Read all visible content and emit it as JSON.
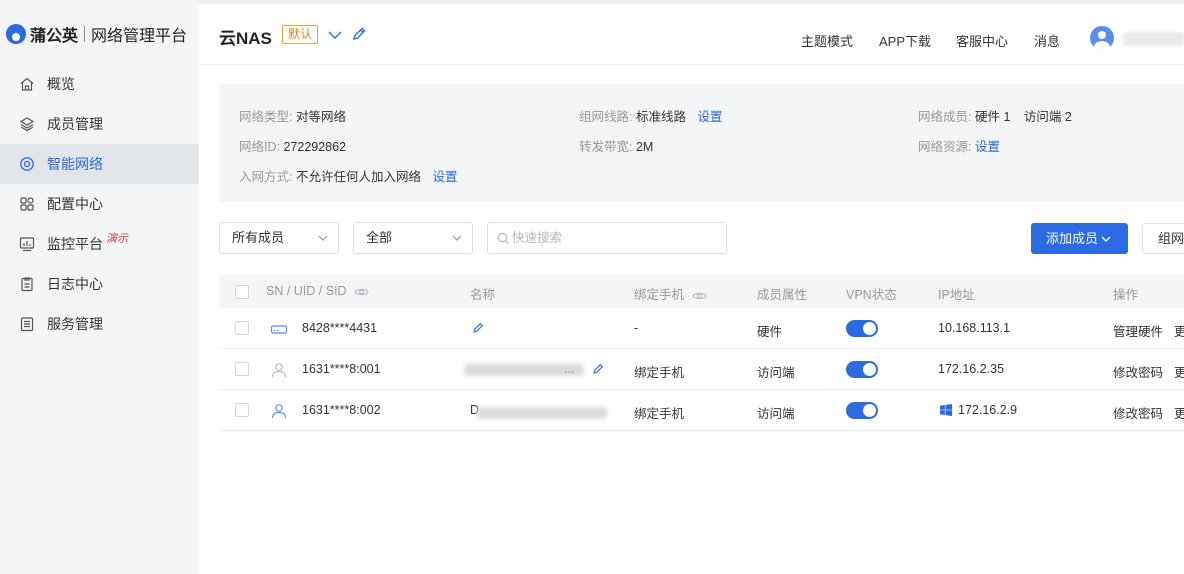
{
  "brand": {
    "name": "蒲公英",
    "subtitle": "网络管理平台"
  },
  "sidebar": {
    "items": [
      {
        "label": "概览",
        "icon": "home-icon",
        "active": false
      },
      {
        "label": "成员管理",
        "icon": "layers-icon",
        "active": false
      },
      {
        "label": "智能网络",
        "icon": "network-icon",
        "active": true
      },
      {
        "label": "配置中心",
        "icon": "grid-icon",
        "active": false
      },
      {
        "label": "监控平台",
        "icon": "monitor-chart-icon",
        "active": false,
        "tag": "演示"
      },
      {
        "label": "日志中心",
        "icon": "clipboard-icon",
        "active": false
      },
      {
        "label": "服务管理",
        "icon": "document-icon",
        "active": false
      }
    ]
  },
  "header": {
    "network_name": "云NAS",
    "default_badge": "默认",
    "links": [
      "主题模式",
      "APP下载",
      "客服中心",
      "消息"
    ]
  },
  "info": {
    "type_label": "网络类型:",
    "type_value": "对等网络",
    "route_label": "组网线路:",
    "route_value": "标准线路",
    "route_action": "设置",
    "members_label": "网络成员:",
    "members_hw": "硬件 1",
    "members_access": "访问端 2",
    "id_label": "网络ID:",
    "id_value": "272292862",
    "bandwidth_label": "转发带宽:",
    "bandwidth_value": "2M",
    "resources_label": "网络资源:",
    "resources_action": "设置",
    "join_label": "入网方式:",
    "join_value": "不允许任何人加入网络",
    "join_action": "设置"
  },
  "filters": {
    "member_select": "所有成员",
    "status_select": "全部",
    "search_placeholder": "快速搜索",
    "add_member": "添加成员",
    "group_button": "组网"
  },
  "table": {
    "headers": {
      "sn": "SN / UID / SID",
      "name": "名称",
      "phone": "绑定手机",
      "attr": "成员属性",
      "vpn": "VPN状态",
      "ip": "IP地址",
      "ops": "操作"
    },
    "rows": [
      {
        "sn": "8428****4431",
        "name_prefix": "",
        "name_suffix": "",
        "phone": "-",
        "attr": "硬件",
        "vpn": true,
        "ip": "10.168.113.1",
        "op1": "管理硬件",
        "op2": "更",
        "icon": "router-icon",
        "os_icon": ""
      },
      {
        "sn": "1631****8:001",
        "name_prefix": "",
        "name_suffix": "...",
        "phone": "绑定手机",
        "attr": "访问端",
        "vpn": true,
        "ip": "172.16.2.35",
        "op1": "修改密码",
        "op2": "更",
        "icon": "user-icon",
        "os_icon": ""
      },
      {
        "sn": "1631****8:002",
        "name_prefix": "D",
        "name_suffix": "",
        "phone": "绑定手机",
        "attr": "访问端",
        "vpn": true,
        "ip": "172.16.2.9",
        "op1": "修改密码",
        "op2": "更",
        "icon": "user-icon",
        "os_icon": "windows-icon"
      }
    ]
  },
  "colors": {
    "primary": "#2b6ae0",
    "sidebar_bg": "#f4f5f7",
    "badge": "#d18a14",
    "demo_tag": "#e0334b"
  }
}
